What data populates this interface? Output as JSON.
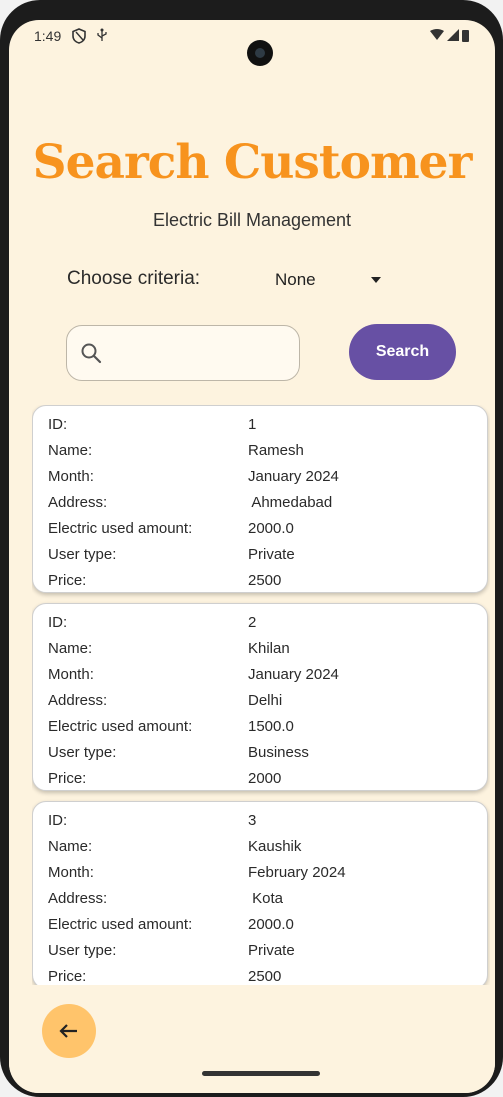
{
  "status_bar": {
    "time": "1:49"
  },
  "title": "Search Customer",
  "subtitle": "Electric Bill Management",
  "criteria": {
    "label": "Choose criteria:",
    "value": "None"
  },
  "search": {
    "placeholder": "",
    "button_label": "Search"
  },
  "field_labels": {
    "id": "ID:",
    "name": "Name:",
    "month": "Month:",
    "address": "Address:",
    "amount": "Electric used amount:",
    "user_type": "User type:",
    "price": "Price:"
  },
  "customers": [
    {
      "id": "1",
      "name": "Ramesh",
      "month": "January 2024",
      "address": " Ahmedabad",
      "amount": "2000.0",
      "user_type": "Private",
      "price": "2500"
    },
    {
      "id": "2",
      "name": "Khilan",
      "month": "January 2024",
      "address": "Delhi",
      "amount": "1500.0",
      "user_type": "Business",
      "price": "2000"
    },
    {
      "id": "3",
      "name": "Kaushik",
      "month": "February 2024",
      "address": " Kota",
      "amount": "2000.0",
      "user_type": "Private",
      "price": "2500"
    }
  ],
  "icons": {
    "back": "arrow-left-icon",
    "search": "search-icon",
    "dropdown": "caret-down-icon"
  },
  "colors": {
    "background": "#fdf3df",
    "title": "#f7931e",
    "primary_button": "#6750a4",
    "fab": "#ffc46b"
  }
}
